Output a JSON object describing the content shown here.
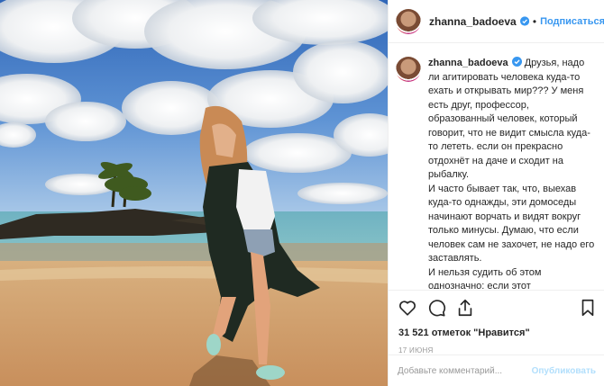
{
  "post": {
    "image_alt": "",
    "username": "zhanna_badoeva",
    "verified_icon": "verified-badge-icon",
    "dot": "•",
    "follow_label": "Подписаться"
  },
  "caption": {
    "username": "zhanna_badoeva",
    "text": " Друзья, надо ли агитировать человека куда-то ехать и открывать мир??? У меня есть друг, профессор, образованный человек, который говорит, что не видит смысла куда-то лететь. если он прекрасно отдохнёт на даче и сходит на рыбалку.\nИ часто бывает так, что, выехав куда-то однажды, эти домоседы начинают ворчать и видят вокруг только минусы. Думаю, что если человек сам не захочет, не надо его заставлять.\nИ нельзя судить об этом однозначно: если этот путешествует – он молодец, а этот сидит дома – он глупец. Если человек отдыхает за городом и ему там очень хорошо,"
  },
  "actions": {
    "icons": [
      "heart-icon",
      "comment-icon",
      "share-icon",
      "bookmark-icon"
    ],
    "likes": "31 521 отметок \"Нравится\"",
    "date": "17 ИЮНЯ"
  },
  "comment_form": {
    "placeholder": "Добавьте комментарий...",
    "publish_label": "Опубликовать"
  },
  "colors": {
    "link_blue": "#3897f0",
    "publish_disabled": "#b2dffc",
    "border": "#efefef",
    "muted_text": "#999999"
  }
}
